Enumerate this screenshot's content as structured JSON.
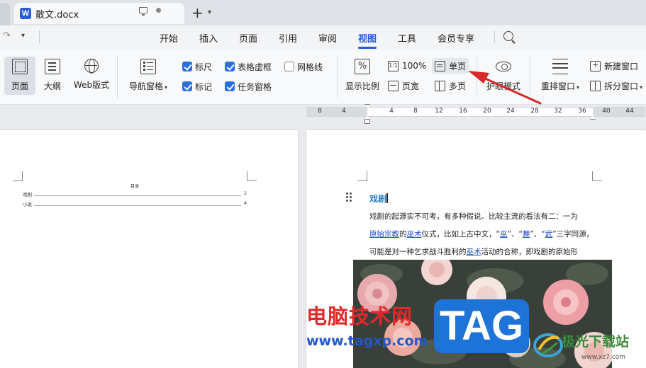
{
  "tabbar": {
    "logo_letter": "W",
    "doc_title": "散文.docx",
    "new_tab": "+",
    "chevron": "⌄"
  },
  "menubar": {
    "items": [
      "开始",
      "插入",
      "页面",
      "引用",
      "审阅",
      "视图",
      "工具",
      "会员专享"
    ],
    "active": "视图"
  },
  "ribbon": {
    "view_modes": [
      {
        "label": "页面"
      },
      {
        "label": "大纲"
      },
      {
        "label": "Web版式"
      }
    ],
    "nav_pane": "导航窗格",
    "checks": [
      {
        "label": "标尺",
        "checked": true
      },
      {
        "label": "表格虚框",
        "checked": true
      },
      {
        "label": "网格线",
        "checked": false
      },
      {
        "label": "标记",
        "checked": true
      },
      {
        "label": "任务窗格",
        "checked": true
      }
    ],
    "zoom_ratio": "显示比例",
    "zoom_ratio_icon": "%",
    "zoom_100": "100%",
    "zoom_100_icon": "1:1",
    "single_page": "单页",
    "page_width": "页宽",
    "multi_page": "多页",
    "eye_mode": "护眼模式",
    "rearrange": "重排窗口",
    "new_window": "新建窗口",
    "split_window": "拆分窗口"
  },
  "ruler": {
    "numbers": [
      "8",
      "4",
      "4",
      "8",
      "12",
      "16",
      "20",
      "24",
      "28",
      "32",
      "36",
      "40",
      "44"
    ]
  },
  "left_page": {
    "toc_title": "目录",
    "toc": [
      {
        "title": "戏剧",
        "page": "2"
      },
      {
        "title": "小说",
        "page": "4"
      }
    ]
  },
  "right_page": {
    "heading": "戏剧",
    "line1": "戏剧的起源实不可考，有多种假说。比较主流的看法有二：一为",
    "line2_parts": [
      "原始宗教",
      "的",
      "巫术",
      "仪式，比如上古中文，“",
      "巫",
      "”、“",
      "舞",
      "”、“",
      "武",
      "”三字同源，"
    ],
    "line3_parts": [
      "可能是对一种乞求战斗胜利的",
      "巫术",
      "活动的合称，即戏剧的原始形"
    ]
  },
  "watermarks": {
    "cn": "电脑技术网",
    "url": "www.tagxp.com",
    "tag": "TAG",
    "xz": "极光下载站",
    "xz_url": "www.xz7.com"
  },
  "colors": {
    "accent": "#2a5bd7",
    "check": "#2a6fe0",
    "heading": "#2a7fc4",
    "arrow": "#d42a2a"
  }
}
